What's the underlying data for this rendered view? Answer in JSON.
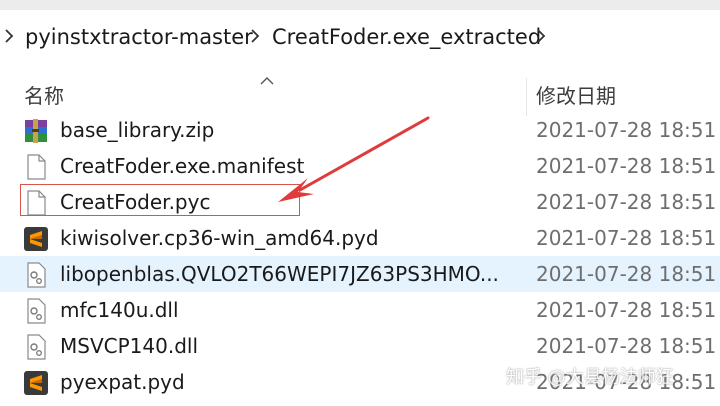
{
  "breadcrumb": {
    "items": [
      {
        "label": "pyinstxtractor-master"
      },
      {
        "label": "CreatFoder.exe_extracted"
      }
    ]
  },
  "columns": {
    "name": "名称",
    "date_modified": "修改日期"
  },
  "files": [
    {
      "name": "base_library.zip",
      "date": "2021-07-28 18:51",
      "icon": "winrar-archive-icon"
    },
    {
      "name": "CreatFoder.exe.manifest",
      "date": "2021-07-28 18:51",
      "icon": "blank-file-icon"
    },
    {
      "name": "CreatFoder.pyc",
      "date": "2021-07-28 18:51",
      "icon": "blank-file-icon"
    },
    {
      "name": "kiwisolver.cp36-win_amd64.pyd",
      "date": "2021-07-28 18:51",
      "icon": "sublime-text-file-icon"
    },
    {
      "name": "libopenblas.QVLO2T66WEPI7JZ63PS3HMO...",
      "date": "2021-07-28 18:51",
      "icon": "dll-gear-file-icon"
    },
    {
      "name": "mfc140u.dll",
      "date": "2021-07-28 18:51",
      "icon": "dll-gear-file-icon"
    },
    {
      "name": "MSVCP140.dll",
      "date": "2021-07-28 18:51",
      "icon": "dll-gear-file-icon"
    },
    {
      "name": "pyexpat.pyd",
      "date": "2021-07-28 18:51",
      "icon": "sublime-text-file-icon"
    }
  ],
  "annotation": {
    "highlight_color": "#d9534f"
  },
  "watermark": "知乎 @大县杨法师狂"
}
